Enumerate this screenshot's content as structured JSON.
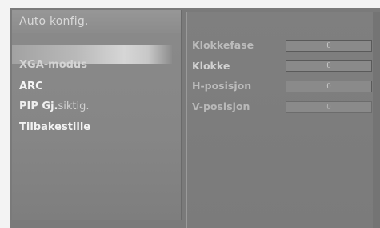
{
  "menu": {
    "title": "Auto konfig.",
    "items": [
      {
        "label": "XGA-modus"
      },
      {
        "label": "ARC"
      },
      {
        "label_bold": "PIP Gj.",
        "label_rest": "siktig."
      },
      {
        "label": "Tilbakestille"
      }
    ]
  },
  "settings": [
    {
      "label": "Klokkefase",
      "value": "0"
    },
    {
      "label": "Klokke",
      "value": "0"
    },
    {
      "label": "H-posisjon",
      "value": "0"
    },
    {
      "label": "V-posisjon",
      "value": "0"
    }
  ]
}
